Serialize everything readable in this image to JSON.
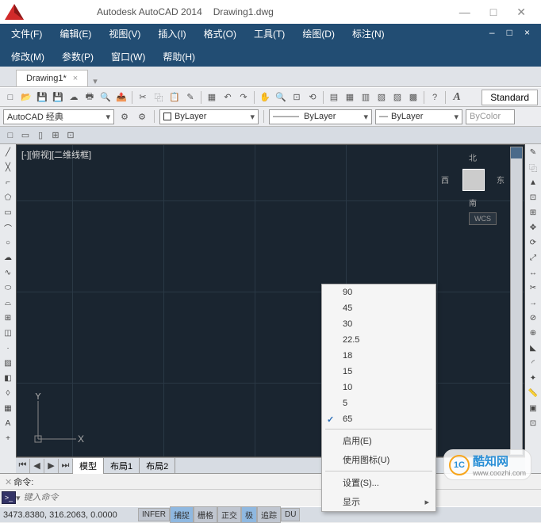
{
  "title": {
    "app": "Autodesk AutoCAD 2014",
    "file": "Drawing1.dwg"
  },
  "menu": {
    "row1": [
      "文件(F)",
      "编辑(E)",
      "视图(V)",
      "插入(I)",
      "格式(O)",
      "工具(T)",
      "绘图(D)",
      "标注(N)"
    ],
    "row2": [
      "修改(M)",
      "参数(P)",
      "窗口(W)",
      "帮助(H)"
    ]
  },
  "tab": {
    "name": "Drawing1*"
  },
  "combos": {
    "workspace": "AutoCAD 经典",
    "layer": "ByLayer",
    "lt": "ByLayer",
    "lw": "ByLayer",
    "color": "ByColor",
    "style": "Standard"
  },
  "viewport": {
    "label": "[-][俯视][二维线框]",
    "compass": {
      "n": "北",
      "e": "东",
      "s": "南",
      "w": "西"
    },
    "wcs": "WCS",
    "ucs_y": "Y",
    "ucs_x": "X"
  },
  "layout_tabs": {
    "model": "模型",
    "l1": "布局1",
    "l2": "布局2"
  },
  "cmd": {
    "label": "命令:",
    "placeholder": "键入命令"
  },
  "status": {
    "coords": "3473.8380, 316.2063, 0.0000",
    "btns": [
      "INFER",
      "捕捉",
      "栅格",
      "正交",
      "极",
      "",
      "",
      "",
      "",
      "追踪",
      "DU"
    ]
  },
  "context": {
    "angles": [
      "90",
      "45",
      "30",
      "22.5",
      "18",
      "15",
      "10",
      "5",
      "65"
    ],
    "checked": "65",
    "enable": "启用(E)",
    "useicon": "使用图标(U)",
    "settings": "设置(S)...",
    "display": "显示"
  },
  "watermark": {
    "logo": "1C",
    "text": "酷知网",
    "url": "www.coozhi.com"
  }
}
